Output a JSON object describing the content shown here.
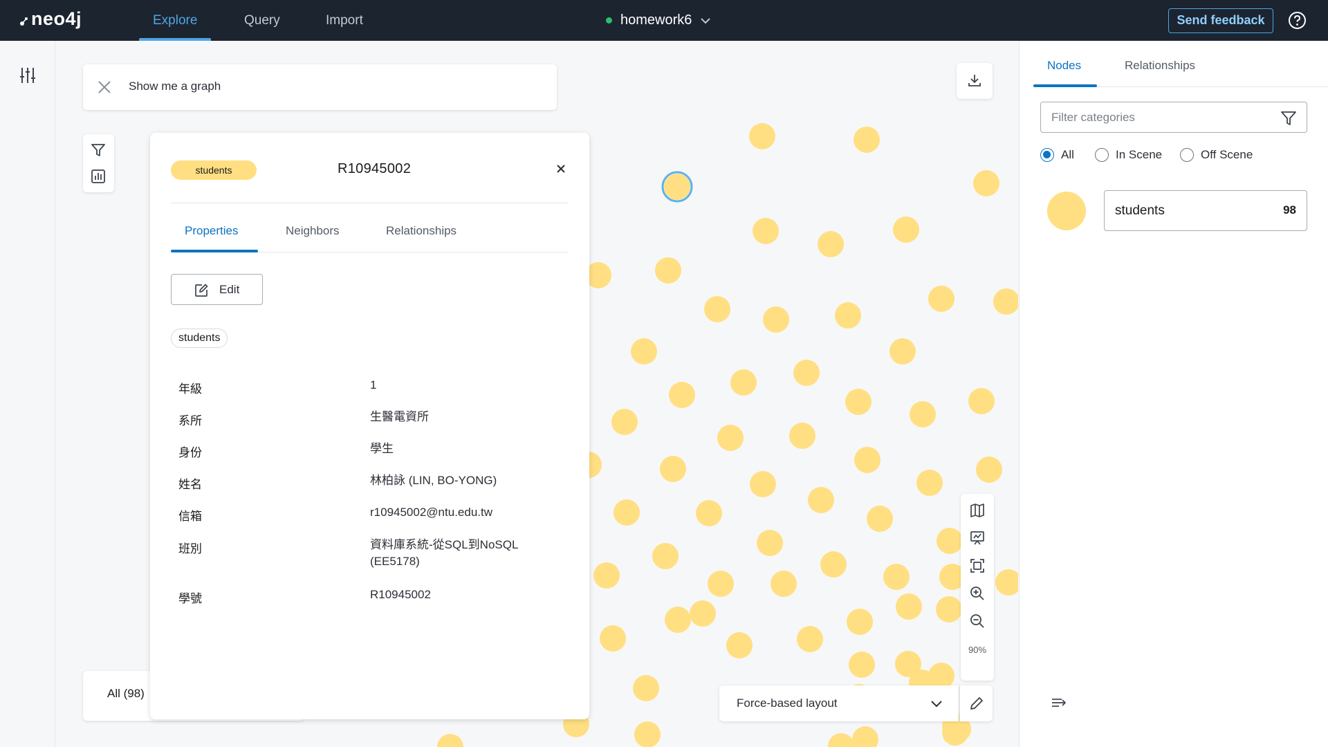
{
  "app": {
    "logo_text": "neo4j"
  },
  "nav": {
    "tabs": [
      {
        "label": "Explore",
        "active": true
      },
      {
        "label": "Query"
      },
      {
        "label": "Import"
      }
    ]
  },
  "database": {
    "name": "homework6",
    "status_color": "#2ebd6b"
  },
  "header": {
    "feedback_label": "Send feedback"
  },
  "search": {
    "text": "Show me a graph"
  },
  "canvas": {
    "node_color": "#ffdf81",
    "selected_ring_color": "#5db3e8",
    "counts_label": "All (98)",
    "zoom_level": "90%",
    "layout_label": "Force-based layout"
  },
  "inspector": {
    "label_pill": "students",
    "title": "R10945002",
    "tabs": [
      {
        "label": "Properties",
        "active": true
      },
      {
        "label": "Neighbors"
      },
      {
        "label": "Relationships"
      }
    ],
    "edit_label": "Edit",
    "label_chip": "students",
    "properties": [
      {
        "key": "年級",
        "value": "1"
      },
      {
        "key": "系所",
        "value": "生醫電資所"
      },
      {
        "key": "身份",
        "value": "學生"
      },
      {
        "key": "姓名",
        "value": "林柏詠 (LIN, BO-YONG)"
      },
      {
        "key": "信箱",
        "value": "r10945002@ntu.edu.tw"
      },
      {
        "key": "班別",
        "value": "資料庫系統-從SQL到NoSQL (EE5178)"
      },
      {
        "key": "學號",
        "value": "R10945002"
      }
    ]
  },
  "right_panel": {
    "tabs": [
      {
        "label": "Nodes",
        "active": true
      },
      {
        "label": "Relationships"
      }
    ],
    "filter_placeholder": "Filter categories",
    "radios": [
      {
        "label": "All",
        "checked": true
      },
      {
        "label": "In Scene"
      },
      {
        "label": "Off Scene"
      }
    ],
    "categories": [
      {
        "name": "students",
        "count": "98",
        "color": "#ffdf81"
      }
    ]
  },
  "colors": {
    "accent": "#0a74c3",
    "topbar": "#1c2430",
    "nav_active": "#4ea6e3"
  }
}
